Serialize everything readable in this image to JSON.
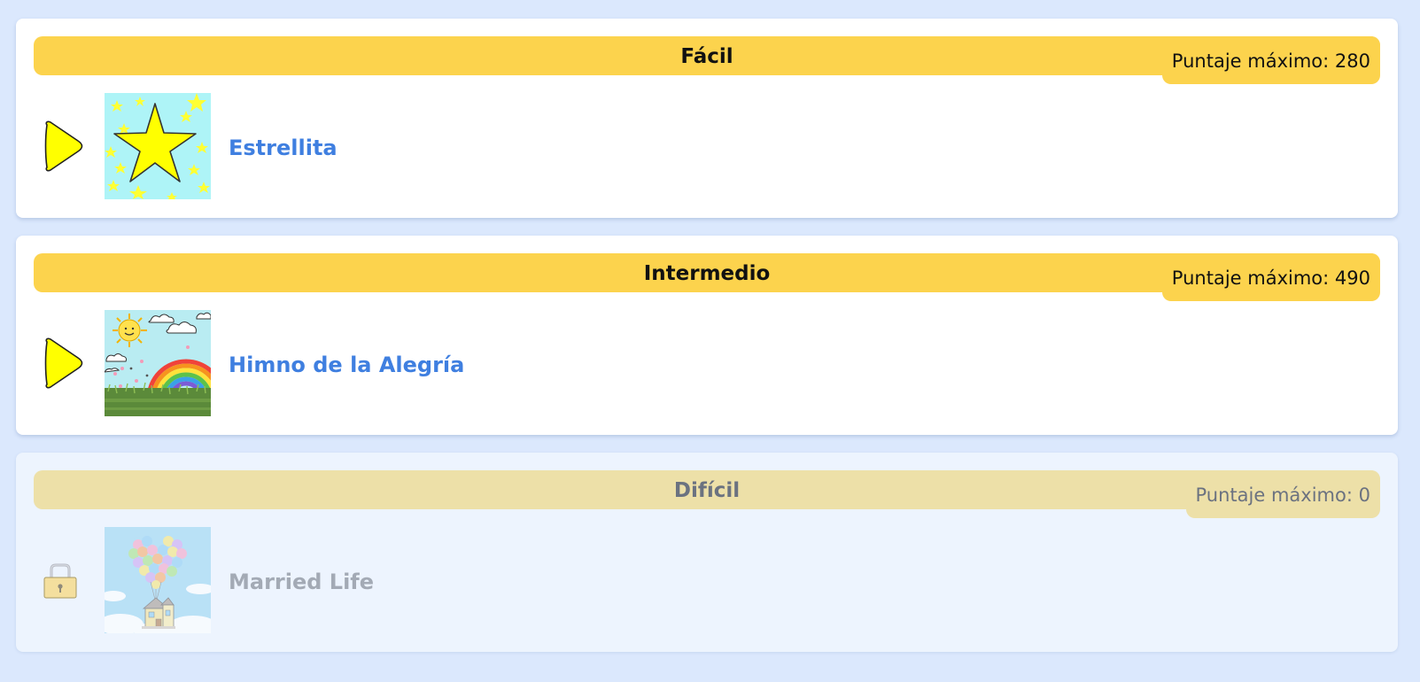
{
  "levels": [
    {
      "title": "Fácil",
      "score_label": "Puntaje máximo:",
      "score_value": "280",
      "song": {
        "title": "Estrellita",
        "thumbnail": "star-thumbnail"
      },
      "status": "unlocked",
      "action_icon": "play-icon"
    },
    {
      "title": "Intermedio",
      "score_label": "Puntaje máximo:",
      "score_value": "490",
      "song": {
        "title": "Himno de la Alegría",
        "thumbnail": "rainbow-thumbnail"
      },
      "status": "unlocked",
      "action_icon": "play-icon"
    },
    {
      "title": "Difícil",
      "score_label": "Puntaje máximo:",
      "score_value": "0",
      "song": {
        "title": "Married Life",
        "thumbnail": "balloon-house-thumbnail"
      },
      "status": "locked",
      "action_icon": "lock-icon"
    }
  ],
  "colors": {
    "background": "#dbe8fd",
    "header": "#fcd34d",
    "header_locked": "#ede0a8",
    "song_link": "#3f7fe0",
    "song_locked": "#a3aab5",
    "play": "#ffff00"
  }
}
